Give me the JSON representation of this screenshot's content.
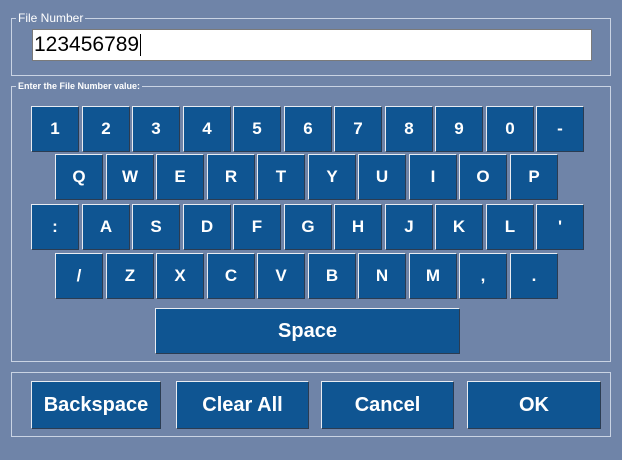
{
  "file_group": {
    "label": "File Number",
    "value": "123456789"
  },
  "keyboard": {
    "label": "Enter the File Number value:",
    "rows": [
      [
        "1",
        "2",
        "3",
        "4",
        "5",
        "6",
        "7",
        "8",
        "9",
        "0",
        "-"
      ],
      [
        "Q",
        "W",
        "E",
        "R",
        "T",
        "Y",
        "U",
        "I",
        "O",
        "P"
      ],
      [
        ":",
        "A",
        "S",
        "D",
        "F",
        "G",
        "H",
        "J",
        "K",
        "L",
        "'"
      ],
      [
        "/",
        "Z",
        "X",
        "C",
        "V",
        "B",
        "N",
        "M",
        ",",
        "."
      ]
    ],
    "space_label": "Space"
  },
  "actions": {
    "backspace": "Backspace",
    "clear_all": "Clear All",
    "cancel": "Cancel",
    "ok": "OK"
  },
  "colors": {
    "background": "#6f84a8",
    "key": "#0f5592",
    "key_text": "#ffffff"
  }
}
